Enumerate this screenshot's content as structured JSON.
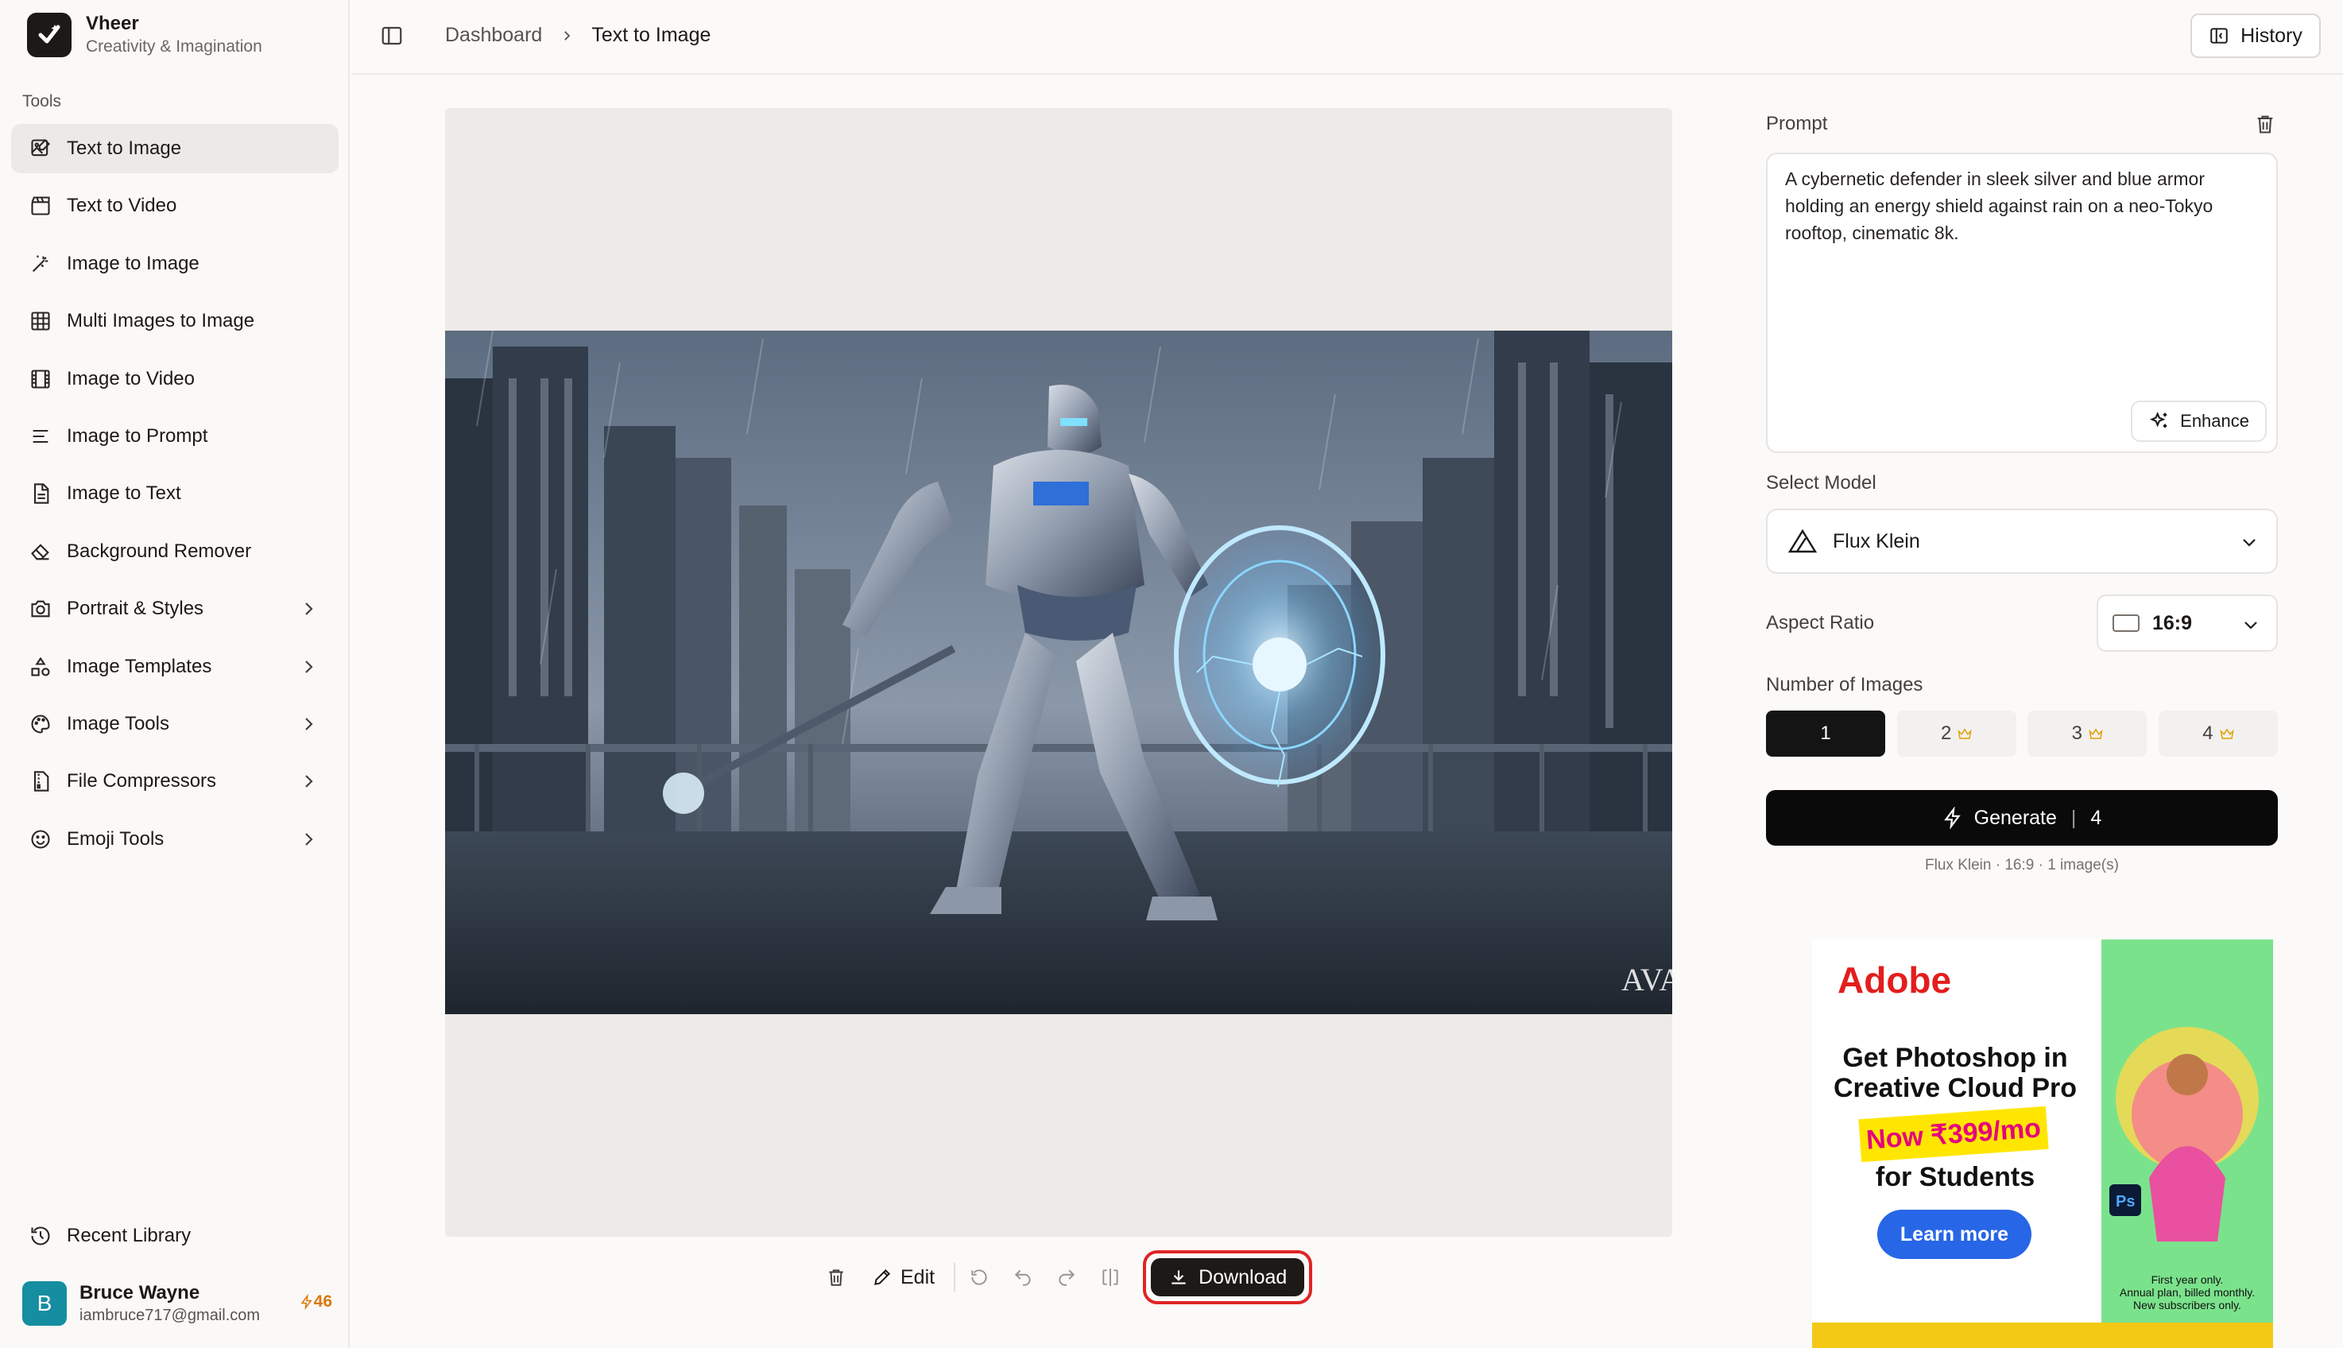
{
  "brand": {
    "name": "Vheer",
    "tagline": "Creativity & Imagination"
  },
  "sidebar": {
    "section_label": "Tools",
    "items": [
      {
        "label": "Text to Image",
        "icon": "image-edit-icon",
        "active": true,
        "has_submenu": false
      },
      {
        "label": "Text to Video",
        "icon": "clapperboard-icon",
        "active": false,
        "has_submenu": false
      },
      {
        "label": "Image to Image",
        "icon": "magic-wand-icon",
        "active": false,
        "has_submenu": false
      },
      {
        "label": "Multi Images to Image",
        "icon": "grid-icon",
        "active": false,
        "has_submenu": false
      },
      {
        "label": "Image to Video",
        "icon": "film-icon",
        "active": false,
        "has_submenu": false
      },
      {
        "label": "Image to Prompt",
        "icon": "text-lines-icon",
        "active": false,
        "has_submenu": false
      },
      {
        "label": "Image to Text",
        "icon": "document-icon",
        "active": false,
        "has_submenu": false
      },
      {
        "label": "Background Remover",
        "icon": "eraser-icon",
        "active": false,
        "has_submenu": false
      },
      {
        "label": "Portrait & Styles",
        "icon": "camera-icon",
        "active": false,
        "has_submenu": true
      },
      {
        "label": "Image Templates",
        "icon": "shapes-icon",
        "active": false,
        "has_submenu": true
      },
      {
        "label": "Image Tools",
        "icon": "palette-icon",
        "active": false,
        "has_submenu": true
      },
      {
        "label": "File Compressors",
        "icon": "file-zip-icon",
        "active": false,
        "has_submenu": true
      },
      {
        "label": "Emoji Tools",
        "icon": "smiley-icon",
        "active": false,
        "has_submenu": true
      }
    ],
    "recent_library": "Recent Library",
    "user": {
      "initial": "B",
      "name": "Bruce Wayne",
      "email": "iambruce717@gmail.com",
      "credits": "46"
    }
  },
  "header": {
    "breadcrumb": [
      "Dashboard",
      "Text to Image"
    ],
    "history_label": "History"
  },
  "toolbar": {
    "edit_label": "Edit",
    "download_label": "Download"
  },
  "panel": {
    "prompt_label": "Prompt",
    "prompt_text": "A cybernetic defender in sleek silver and blue armor holding an energy shield against rain on a neo-Tokyo rooftop, cinematic 8k.",
    "enhance_label": "Enhance",
    "model_label": "Select Model",
    "model_value": "Flux Klein",
    "aspect_label": "Aspect Ratio",
    "aspect_value": "16:9",
    "count_label": "Number of Images",
    "counts": [
      "1",
      "2",
      "3",
      "4"
    ],
    "selected_count": "1",
    "generate_label": "Generate",
    "generate_cost": "4",
    "meta": "Flux Klein · 16:9 · 1 image(s)"
  },
  "ad": {
    "brand": "Adobe",
    "headline_1": "Get Photoshop in",
    "headline_2": "Creative Cloud Pro",
    "price": "Now ₹399/mo",
    "sub": "for Students",
    "cta": "Learn more",
    "fine_1": "First year only.",
    "fine_2": "Annual plan, billed monthly.",
    "fine_3": "New subscribers only."
  },
  "colors": {
    "accent_dark": "#0a0a0a",
    "download_highlight": "#e02424",
    "credits": "#d97706",
    "avatar": "#148ea0"
  }
}
